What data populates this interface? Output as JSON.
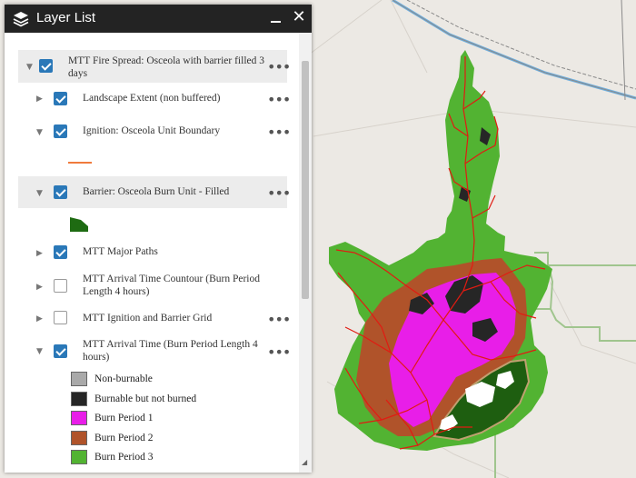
{
  "panel": {
    "title": "Layer List",
    "icons": {
      "layers": "layers-icon",
      "minimize": "minimize-icon",
      "close": "close-icon"
    },
    "close_glyph": "✕"
  },
  "layers": [
    {
      "label_line1": "MTT Fire Spread: Osceola with barrier filled 3",
      "label_line2": "days",
      "checked": true,
      "expanded": true,
      "has_menu": true
    },
    {
      "label_line1": "Landscape Extent (non buffered)",
      "checked": true,
      "expanded": false,
      "has_menu": true
    },
    {
      "label_line1": "Ignition: Osceola Unit Boundary",
      "checked": true,
      "expanded": true,
      "has_menu": true
    },
    {
      "label_line1": "Barrier: Osceola Burn Unit - Filled",
      "checked": true,
      "expanded": true,
      "has_menu": true
    },
    {
      "label_line1": "MTT Major Paths",
      "checked": true,
      "expanded": false,
      "has_menu": false
    },
    {
      "label_line1": "MTT Arrival Time Countour (Burn Period",
      "label_line2": "Length 4 hours)",
      "checked": false,
      "expanded": false,
      "has_menu": false
    },
    {
      "label_line1": "MTT Ignition and Barrier Grid",
      "checked": false,
      "expanded": false,
      "has_menu": true
    },
    {
      "label_line1": "MTT Arrival Time (Burn Period Length 4",
      "label_line2": "hours)",
      "checked": true,
      "expanded": true,
      "has_menu": true
    }
  ],
  "legend": [
    {
      "label": "Non-burnable",
      "color": "#a9a9a9"
    },
    {
      "label": "Burnable but not burned",
      "color": "#262626"
    },
    {
      "label": "Burn Period 1",
      "color": "#e81ee8"
    },
    {
      "label": "Burn Period 2",
      "color": "#b0532a"
    },
    {
      "label": "Burn Period 3",
      "color": "#52b332"
    }
  ],
  "symbols": {
    "ignition_line_color": "#f07a3c",
    "barrier_fill_color": "#1e6b12"
  },
  "colors": {
    "accent": "#2a78b8",
    "title_bar": "#232323",
    "map_background": "#ece9e4",
    "road_lines": "#a0c58e",
    "major_paths": "#e11b12",
    "barrier_area": "#1e5e10",
    "highway_blue": "#6fb0e0"
  }
}
